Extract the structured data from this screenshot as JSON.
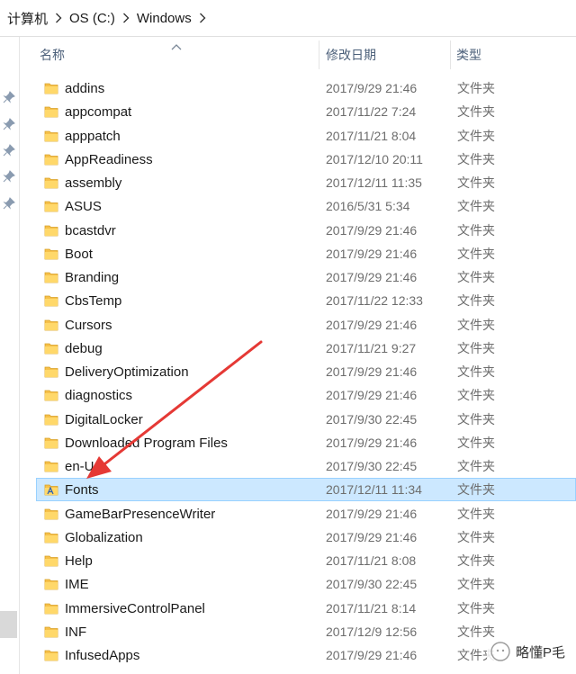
{
  "breadcrumb": [
    "计算机",
    "OS (C:)",
    "Windows"
  ],
  "columns": {
    "name": "名称",
    "date": "修改日期",
    "type": "类型"
  },
  "rows": [
    {
      "name": "addins",
      "date": "2017/9/29 21:46",
      "type": "文件夹",
      "icon": "folder-icon"
    },
    {
      "name": "appcompat",
      "date": "2017/11/22 7:24",
      "type": "文件夹",
      "icon": "folder-icon"
    },
    {
      "name": "apppatch",
      "date": "2017/11/21 8:04",
      "type": "文件夹",
      "icon": "folder-icon"
    },
    {
      "name": "AppReadiness",
      "date": "2017/12/10 20:11",
      "type": "文件夹",
      "icon": "folder-icon"
    },
    {
      "name": "assembly",
      "date": "2017/12/11 11:35",
      "type": "文件夹",
      "icon": "folder-icon"
    },
    {
      "name": "ASUS",
      "date": "2016/5/31 5:34",
      "type": "文件夹",
      "icon": "folder-icon"
    },
    {
      "name": "bcastdvr",
      "date": "2017/9/29 21:46",
      "type": "文件夹",
      "icon": "folder-icon"
    },
    {
      "name": "Boot",
      "date": "2017/9/29 21:46",
      "type": "文件夹",
      "icon": "folder-icon"
    },
    {
      "name": "Branding",
      "date": "2017/9/29 21:46",
      "type": "文件夹",
      "icon": "folder-icon"
    },
    {
      "name": "CbsTemp",
      "date": "2017/11/22 12:33",
      "type": "文件夹",
      "icon": "folder-icon"
    },
    {
      "name": "Cursors",
      "date": "2017/9/29 21:46",
      "type": "文件夹",
      "icon": "folder-icon"
    },
    {
      "name": "debug",
      "date": "2017/11/21 9:27",
      "type": "文件夹",
      "icon": "folder-icon"
    },
    {
      "name": "DeliveryOptimization",
      "date": "2017/9/29 21:46",
      "type": "文件夹",
      "icon": "folder-icon"
    },
    {
      "name": "diagnostics",
      "date": "2017/9/29 21:46",
      "type": "文件夹",
      "icon": "folder-icon"
    },
    {
      "name": "DigitalLocker",
      "date": "2017/9/30 22:45",
      "type": "文件夹",
      "icon": "folder-icon"
    },
    {
      "name": "Downloaded Program Files",
      "date": "2017/9/29 21:46",
      "type": "文件夹",
      "icon": "folder-icon"
    },
    {
      "name": "en-US",
      "date": "2017/9/30 22:45",
      "type": "文件夹",
      "icon": "folder-icon"
    },
    {
      "name": "Fonts",
      "date": "2017/12/11 11:34",
      "type": "文件夹",
      "icon": "fonts-folder-icon",
      "selected": true
    },
    {
      "name": "GameBarPresenceWriter",
      "date": "2017/9/29 21:46",
      "type": "文件夹",
      "icon": "folder-icon"
    },
    {
      "name": "Globalization",
      "date": "2017/9/29 21:46",
      "type": "文件夹",
      "icon": "folder-icon"
    },
    {
      "name": "Help",
      "date": "2017/11/21 8:08",
      "type": "文件夹",
      "icon": "folder-icon"
    },
    {
      "name": "IME",
      "date": "2017/9/30 22:45",
      "type": "文件夹",
      "icon": "folder-icon"
    },
    {
      "name": "ImmersiveControlPanel",
      "date": "2017/11/21 8:14",
      "type": "文件夹",
      "icon": "folder-icon"
    },
    {
      "name": "INF",
      "date": "2017/12/9 12:56",
      "type": "文件夹",
      "icon": "folder-icon"
    },
    {
      "name": "InfusedApps",
      "date": "2017/9/29 21:46",
      "type": "文件夹",
      "icon": "folder-icon"
    }
  ],
  "watermark": "略懂P毛",
  "colors": {
    "selection_bg": "#cce8ff",
    "selection_border": "#99d1ff",
    "folder": "#f6c04a",
    "arrow": "#e53935",
    "header_text": "#4c607a",
    "meta_text": "#6d6d6d"
  }
}
